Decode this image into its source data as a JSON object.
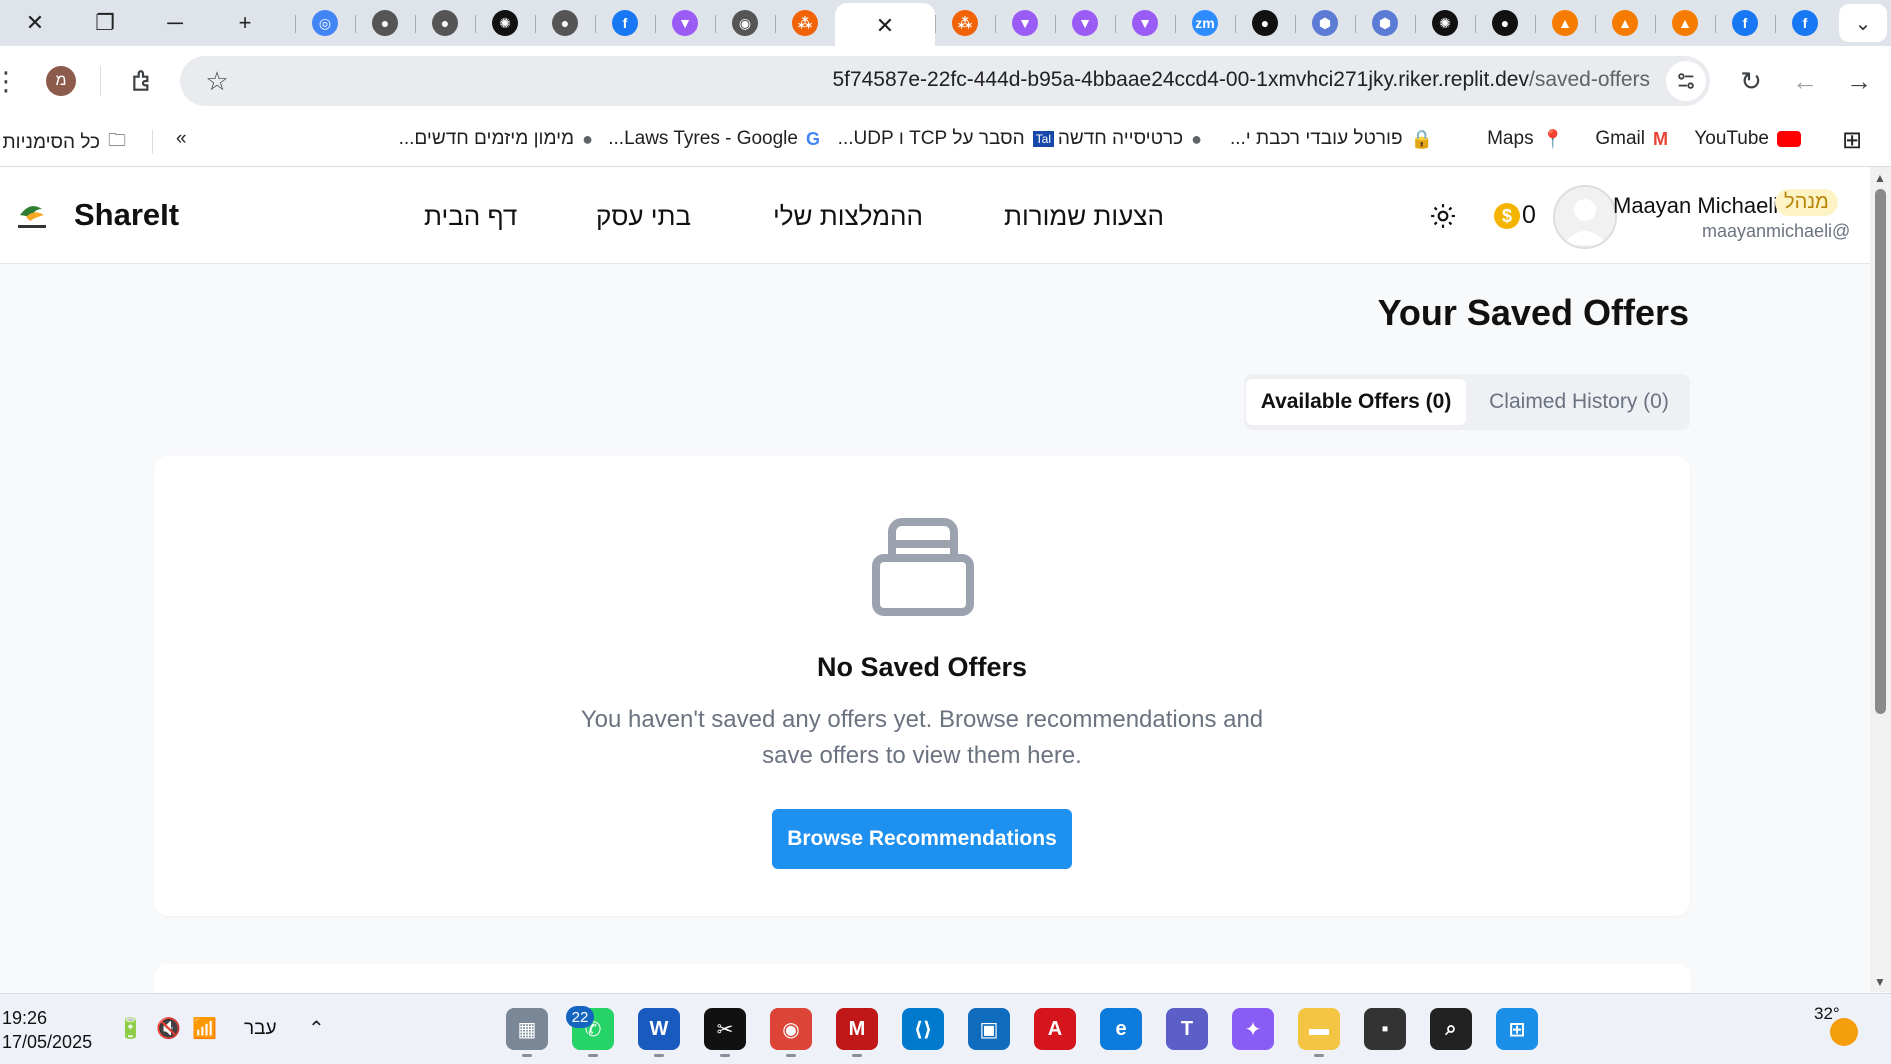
{
  "browser": {
    "window_controls": {
      "close": "✕",
      "restore": "❐",
      "minimize": "─",
      "new_tab": "+"
    },
    "tabs": [
      {
        "icon": "chevron-down-icon",
        "label": "⌄"
      },
      {
        "icon": "instagram-icon",
        "color": "#1877f2"
      },
      {
        "icon": "facebook-icon",
        "color": "#1877f2"
      },
      {
        "icon": "fire-icon",
        "color": "#f57c00"
      },
      {
        "icon": "fire-icon",
        "color": "#f57c00"
      },
      {
        "icon": "fire-icon",
        "color": "#f57c00"
      },
      {
        "icon": "github-icon",
        "color": "#111111"
      },
      {
        "icon": "openai-icon",
        "color": "#111111"
      },
      {
        "icon": "cube-icon",
        "color": "#5b7bd5"
      },
      {
        "icon": "cube-icon",
        "color": "#5b7bd5"
      },
      {
        "icon": "github-icon",
        "color": "#111111"
      },
      {
        "icon": "zoom-icon",
        "color": "#2d8cff"
      },
      {
        "icon": "vite-icon",
        "color": "#9b5cf6"
      },
      {
        "icon": "vite-icon",
        "color": "#9b5cf6"
      },
      {
        "icon": "vite-icon",
        "color": "#9b5cf6"
      },
      {
        "icon": "replit-icon",
        "color": "#f26207"
      },
      {
        "icon": "close-icon",
        "label": "✕",
        "active": true
      },
      {
        "icon": "replit-icon",
        "color": "#f26207"
      },
      {
        "icon": "chrome-icon",
        "color": "#555555"
      },
      {
        "icon": "vite-icon",
        "color": "#9b5cf6"
      },
      {
        "icon": "facebook-icon",
        "color": "#1877f2"
      },
      {
        "icon": "globe-icon",
        "color": "#555555"
      },
      {
        "icon": "openai-icon",
        "color": "#111111"
      },
      {
        "icon": "globe-icon",
        "color": "#555555"
      },
      {
        "icon": "globe-icon",
        "color": "#555555"
      },
      {
        "icon": "google-lens-icon",
        "color": "#4285f4"
      }
    ],
    "profile_initial": "מ",
    "url_host": "5f74587e-22fc-444d-b95a-4bbaae24ccd4-00-1xmvhci271jky.riker.replit.dev",
    "url_path": "/saved-offers",
    "bookmarks": [
      {
        "label": "YouTube",
        "icon": "youtube-icon"
      },
      {
        "label": "Gmail",
        "icon": "gmail-icon"
      },
      {
        "label": "Maps",
        "icon": "maps-icon"
      },
      {
        "label": "פורטל עובדי רכבת י...",
        "icon": "briefcase-icon"
      },
      {
        "label": "כרטיסייה חדשה",
        "icon": "globe-icon"
      },
      {
        "label": "הסבר על TCP ו UDP...",
        "icon": "tal-icon"
      },
      {
        "label": "Laws Tyres - Google...",
        "icon": "google-icon"
      },
      {
        "label": "מימון מיזמים חדשים...",
        "icon": "globe-icon"
      }
    ],
    "bookmarks_overflow": "»",
    "all_bookmarks": "כל הסימניות"
  },
  "app": {
    "brand": "ShareIt",
    "nav": [
      "דף הבית",
      "בתי עסק",
      "ההמלצות שלי",
      "הצעות שמורות"
    ],
    "coins": "0",
    "user_name": "Maayan Michaeli",
    "user_role": "מנהל",
    "user_email": "maayanmichaeli@",
    "page_title": "Your Saved Offers",
    "tabs": {
      "available": "Available Offers (0)",
      "claimed": "Claimed History (0)"
    },
    "empty": {
      "title": "No Saved Offers",
      "text": "You haven't saved any offers yet. Browse recommendations and save offers to view them here.",
      "button": "Browse Recommendations"
    },
    "accent": "#1e90ef"
  },
  "taskbar": {
    "time": "19:26",
    "date": "17/05/2025",
    "language": "עבר",
    "whatsapp_badge": "22",
    "temperature": "32°",
    "apps": [
      {
        "icon": "calculator-icon",
        "color": "#7a8796"
      },
      {
        "icon": "whatsapp-icon",
        "color": "#25d366"
      },
      {
        "icon": "word-icon",
        "color": "#185abd"
      },
      {
        "icon": "capcut-icon",
        "color": "#111111"
      },
      {
        "icon": "chrome-icon",
        "color": "#db4437"
      },
      {
        "icon": "mcafee-icon",
        "color": "#c01818"
      },
      {
        "icon": "vscode-icon",
        "color": "#007acc"
      },
      {
        "icon": "store-icon",
        "color": "#0f6cbd"
      },
      {
        "icon": "acrobat-icon",
        "color": "#d4161c"
      },
      {
        "icon": "edge-icon",
        "color": "#0c7bdc"
      },
      {
        "icon": "teams-icon",
        "color": "#5b5fc7"
      },
      {
        "icon": "copilot-icon",
        "color": "#8a5cf6"
      },
      {
        "icon": "file-explorer-icon",
        "color": "#f4c542"
      },
      {
        "icon": "terminal-icon",
        "color": "#333333"
      },
      {
        "icon": "search-icon",
        "color": "#222222"
      },
      {
        "icon": "windows-start-icon",
        "color": "#1b8ee8"
      }
    ]
  }
}
